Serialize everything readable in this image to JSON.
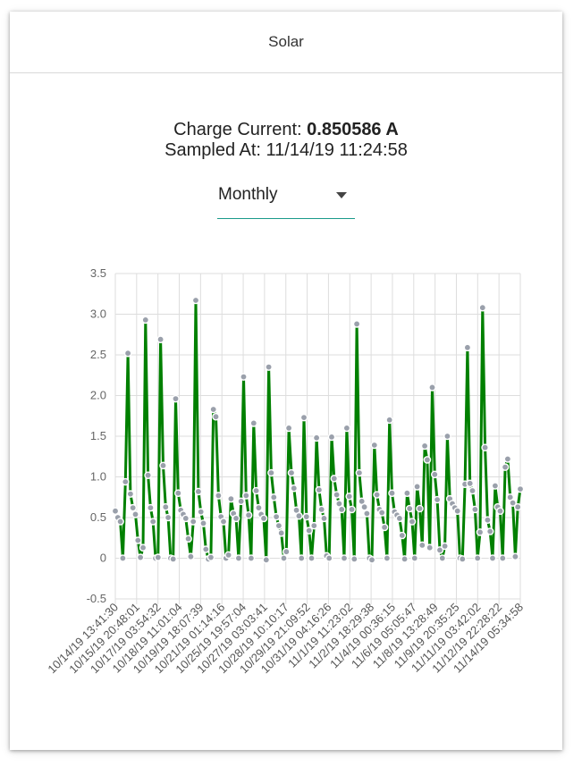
{
  "card": {
    "title": "Solar"
  },
  "readout": {
    "label": "Charge Current:",
    "value": "0.850586 A",
    "sampled_label": "Sampled At:",
    "sampled_value": "11/14/19 11:24:58"
  },
  "period_select": {
    "value": "Monthly"
  },
  "colors": {
    "line": "#008000",
    "point_fill": "#9aa0ab",
    "point_stroke": "#ffffff",
    "grid": "#dddddd",
    "accent": "#1a9a8a"
  },
  "chart_data": {
    "type": "line",
    "title": "",
    "xlabel": "",
    "ylabel": "",
    "ylim": [
      -0.5,
      3.5
    ],
    "yticks": [
      -0.5,
      0,
      0.5,
      1.0,
      1.5,
      2.0,
      2.5,
      3.0,
      3.5
    ],
    "ytick_labels": [
      "-0.5",
      "0",
      "0.5",
      "1.0",
      "1.5",
      "2.0",
      "2.5",
      "3.0",
      "3.5"
    ],
    "grid": true,
    "xtick_labels": [
      "10/14/19 13:41:30",
      "10/15/19 20:48:01",
      "10/17/19 03:54:32",
      "10/18/19 11:01:04",
      "10/19/19 18:07:39",
      "10/21/19 01:14:16",
      "10/25/19 19:57:04",
      "10/27/19 03:03:41",
      "10/28/19 10:10:17",
      "10/29/19 21:09:52",
      "10/31/19 04:16:26",
      "11/1/19 11:23:02",
      "11/2/19 18:29:38",
      "11/4/19 00:36:15",
      "11/6/19 05:05:47",
      "11/8/19 13:28:49",
      "11/9/19 20:35:25",
      "11/11/19 03:42:02",
      "11/12/19 22:28:22",
      "11/14/19 05:34:58"
    ],
    "peaks": [
      2.52,
      2.93,
      2.69,
      1.96,
      3.17,
      1.83,
      0.73,
      2.23,
      1.66,
      2.35,
      1.6,
      1.73,
      1.48,
      1.49,
      1.6,
      2.88,
      1.39,
      0.8,
      1.7,
      0.88,
      1.38,
      2.1,
      1.5,
      2.59,
      0.92,
      3.08,
      0.89,
      1.22,
      0.85
    ],
    "series": [
      {
        "values": [
          0.58,
          0.5,
          0.45,
          0.0,
          0.94,
          2.52,
          0.79,
          0.62,
          0.54,
          0.22,
          0.01,
          0.13,
          2.93,
          1.02,
          0.62,
          0.45,
          0.0,
          0.01,
          2.69,
          1.14,
          0.63,
          0.5,
          0.0,
          -0.01,
          1.96,
          0.8,
          0.59,
          0.54,
          0.49,
          0.24,
          0.02,
          0.45,
          3.17,
          0.82,
          0.57,
          0.43,
          0.11,
          -0.01,
          0.01,
          1.83,
          1.74,
          0.77,
          0.51,
          0.45,
          0.0,
          0.04,
          0.73,
          0.55,
          0.49,
          0.0,
          0.7,
          2.23,
          0.77,
          0.53,
          0.0,
          1.66,
          0.83,
          0.62,
          0.54,
          0.49,
          -0.02,
          2.35,
          1.05,
          0.75,
          0.51,
          0.4,
          0.31,
          0.0,
          0.08,
          1.6,
          1.05,
          0.86,
          0.59,
          0.52,
          0.0,
          1.73,
          0.51,
          0.34,
          0.0,
          0.4,
          1.48,
          0.84,
          0.6,
          0.49,
          0.03,
          0.0,
          1.49,
          0.98,
          0.78,
          0.67,
          0.6,
          0.0,
          1.6,
          0.76,
          0.6,
          -0.01,
          2.88,
          1.05,
          0.7,
          0.63,
          0.55,
          0.0,
          -0.02,
          1.39,
          0.78,
          0.6,
          0.56,
          0.38,
          0.0,
          1.7,
          0.8,
          0.57,
          0.53,
          0.49,
          0.28,
          -0.01,
          0.8,
          0.61,
          0.45,
          0.0,
          0.88,
          0.61,
          0.16,
          1.38,
          1.21,
          0.13,
          2.1,
          1.03,
          0.72,
          0.1,
          0.0,
          0.15,
          1.5,
          0.73,
          0.67,
          0.62,
          0.58,
          0.0,
          -0.01,
          0.91,
          2.59,
          0.92,
          0.83,
          0.6,
          0.0,
          0.32,
          3.08,
          1.36,
          0.47,
          0.33,
          0.0,
          0.89,
          0.63,
          0.58,
          0.0,
          1.12,
          1.22,
          0.75,
          0.68,
          0.02,
          0.63,
          0.85
        ]
      }
    ]
  }
}
